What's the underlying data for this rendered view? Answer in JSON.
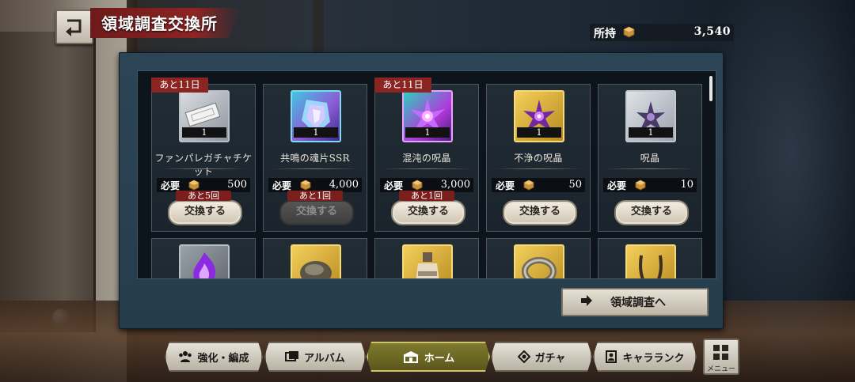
{
  "header": {
    "title": "領域調査交換所",
    "owned_label": "所持",
    "owned_value": "3,540"
  },
  "cards": [
    {
      "name": "ファンパレガチャチケット",
      "qty": "1",
      "cost_label": "必要",
      "cost": "500",
      "limit": "あと5回",
      "button": "交換する",
      "button_enabled": true,
      "date_tag": "あと11日",
      "icon": "ticket-icon"
    },
    {
      "name": "共鳴の魂片SSR",
      "qty": "1",
      "cost_label": "必要",
      "cost": "4,000",
      "limit": "あと1回",
      "button": "交換する",
      "button_enabled": false,
      "date_tag": "",
      "icon": "ssr-crystal-icon"
    },
    {
      "name": "混沌の呪晶",
      "qty": "1",
      "cost_label": "必要",
      "cost": "3,000",
      "limit": "あと1回",
      "button": "交換する",
      "button_enabled": true,
      "date_tag": "あと11日",
      "icon": "chaos-crystal-icon"
    },
    {
      "name": "不浄の呪晶",
      "qty": "1",
      "cost_label": "必要",
      "cost": "50",
      "limit": "",
      "button": "交換する",
      "button_enabled": true,
      "date_tag": "",
      "icon": "impure-crystal-icon"
    },
    {
      "name": "呪晶",
      "qty": "1",
      "cost_label": "必要",
      "cost": "10",
      "limit": "",
      "button": "交換する",
      "button_enabled": true,
      "date_tag": "",
      "icon": "crystal-icon"
    }
  ],
  "second_row_icons": [
    "purple-flame-icon",
    "stone-icon",
    "bottle-icon",
    "bracelet-icon",
    "necklace-icon"
  ],
  "to_survey_label": "領域調査へ",
  "nav": {
    "upgrade": "強化・編成",
    "album": "アルバム",
    "home": "ホーム",
    "gacha": "ガチャ",
    "chara_rank": "キャラランク",
    "menu": "メニュー"
  },
  "colors": {
    "title_banner": "#8e2424",
    "date_tag": "#8b2522",
    "nav_active": "#6b6722",
    "panel": "#2c4556"
  }
}
